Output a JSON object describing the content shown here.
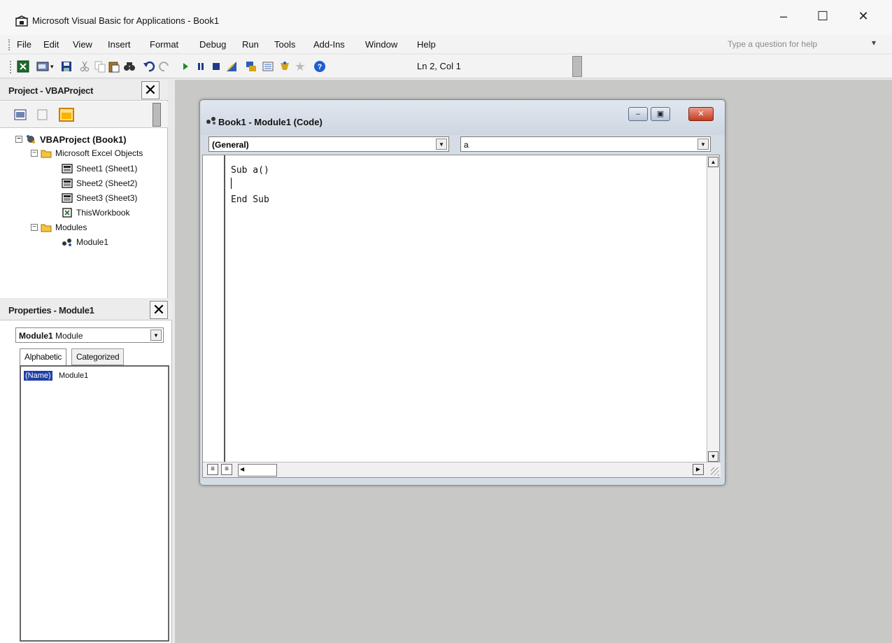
{
  "window": {
    "title": "Microsoft Visual Basic for Applications - Book1",
    "controls": {
      "minimize": "–",
      "maximize": "☐",
      "close": "✕"
    }
  },
  "menu": {
    "items": [
      "File",
      "Edit",
      "View",
      "Insert",
      "Format",
      "Debug",
      "Run",
      "Tools",
      "Add-Ins",
      "Window",
      "Help"
    ],
    "help_placeholder": "Type a question for help"
  },
  "toolbar": {
    "icons": [
      "excel-icon",
      "insert-userform-icon",
      "save-icon",
      "cut-icon",
      "copy-icon",
      "paste-icon",
      "find-icon",
      "undo-icon",
      "redo-icon",
      "run-icon",
      "break-icon",
      "reset-icon",
      "design-mode-icon",
      "project-explorer-icon",
      "properties-icon",
      "object-browser-icon",
      "toolbox-icon",
      "help-icon"
    ],
    "position": "Ln 2, Col 1"
  },
  "project_panel": {
    "title": "Project - VBAProject",
    "close": "✕",
    "tree": [
      {
        "label": "VBAProject (Book1)",
        "icon": "vba-project-icon",
        "expander": "−"
      },
      {
        "label": "Microsoft Excel Objects",
        "icon": "folder-icon",
        "expander": "−"
      },
      {
        "label": "Sheet1 (Sheet1)",
        "icon": "sheet-icon"
      },
      {
        "label": "Sheet2 (Sheet2)",
        "icon": "sheet-icon"
      },
      {
        "label": "Sheet3 (Sheet3)",
        "icon": "sheet-icon"
      },
      {
        "label": "ThisWorkbook",
        "icon": "workbook-icon"
      },
      {
        "label": "Modules",
        "icon": "folder-icon",
        "expander": "−"
      },
      {
        "label": "Module1",
        "icon": "module-icon"
      }
    ]
  },
  "properties_panel": {
    "title": "Properties - Module1",
    "close": "✕",
    "object_name": "Module1",
    "object_type": "Module",
    "tabs": [
      "Alphabetic",
      "Categorized"
    ],
    "rows": [
      {
        "key": "(Name)",
        "value": "Module1"
      }
    ]
  },
  "code_window": {
    "title": "Book1 - Module1 (Code)",
    "object_combo": "(General)",
    "procedure_combo": "a",
    "lines": [
      "Sub a()",
      "",
      "End Sub"
    ],
    "buttons": {
      "minimize": "–",
      "restore": "▣",
      "close": "✕"
    }
  },
  "colors": {
    "selection": "#1f3fa6",
    "mdi_background": "#c8c8c6",
    "close_button": "#c43b1f"
  }
}
